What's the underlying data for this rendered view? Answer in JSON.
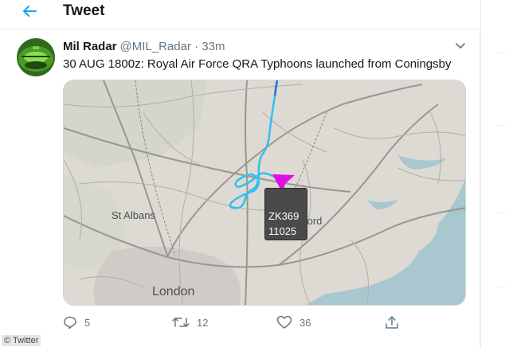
{
  "header": {
    "title": "Tweet",
    "back_icon": "arrow-left-icon"
  },
  "tweet": {
    "author_name": "Mil Radar",
    "handle": "@MIL_Radar",
    "separator": "·",
    "time": "33m",
    "text": "30 AUG 1800z: Royal Air Force QRA Typhoons launched from Coningsby",
    "media": {
      "map_labels": {
        "st_albans": "St Albans",
        "london": "London",
        "ford": "ford"
      },
      "flight_callsign": "ZK369",
      "flight_altitude": "11025"
    }
  },
  "actions": {
    "reply_count": "5",
    "retweet_count": "12",
    "like_count": "36"
  },
  "watermark": "© Twitter",
  "colors": {
    "accent": "#1da1f2",
    "track": "#2fc0f0",
    "aircraft": "#e10ee6",
    "muted": "#657786"
  }
}
